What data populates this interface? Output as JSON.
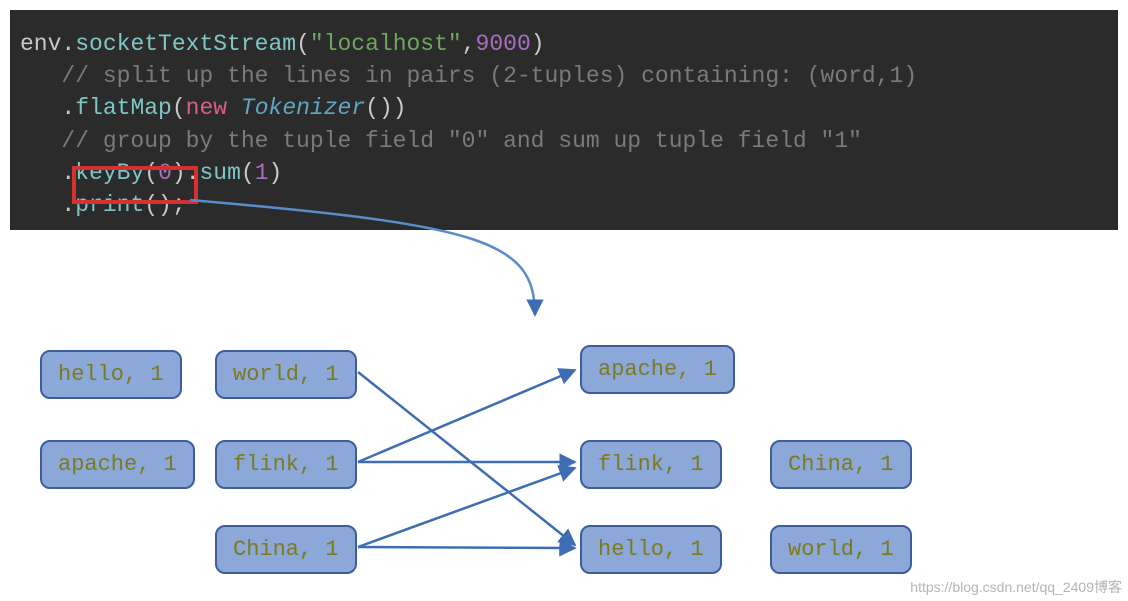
{
  "code": {
    "line1": {
      "env": "env",
      "dot1": ".",
      "method": "socketTextStream",
      "open": "(",
      "str": "\"localhost\"",
      "comma": ",",
      "num": "9000",
      "close": ")"
    },
    "line2_comment": "   // split up the lines in pairs (2-tuples) containing: (word,1)",
    "line3": {
      "indent": "   ",
      "dot": ".",
      "method": "flatMap",
      "open": "(",
      "kw": "new",
      "space": " ",
      "cls": "Tokenizer",
      "parens": "()",
      "close": ")"
    },
    "line4_comment": "   // group by the tuple field \"0\" and sum up tuple field \"1\"",
    "line5": {
      "indent": "   ",
      "dot1": ".",
      "method1": "keyBy",
      "open1": "(",
      "num1": "0",
      "close1": ")",
      "dot2": ".",
      "method2": "sum",
      "open2": "(",
      "num2": "1",
      "close2": ")"
    },
    "line6": {
      "indent": "   ",
      "dot": ".",
      "method": "print",
      "parens": "();"
    }
  },
  "tuples_left": [
    {
      "label": "hello, 1"
    },
    {
      "label": "world, 1"
    },
    {
      "label": "apache, 1"
    },
    {
      "label": "flink, 1"
    },
    {
      "label": "China, 1"
    }
  ],
  "tuples_right": [
    {
      "label": "apache, 1"
    },
    {
      "label": "flink, 1"
    },
    {
      "label": "China, 1"
    },
    {
      "label": "hello, 1"
    },
    {
      "label": "world, 1"
    }
  ],
  "arrows": [
    {
      "from": "world-l",
      "to": "hello-r"
    },
    {
      "from": "flink-l",
      "to": "apache-r"
    },
    {
      "from": "flink-l",
      "to": "flink-r"
    },
    {
      "from": "China-l",
      "to": "flink-r"
    },
    {
      "from": "China-l",
      "to": "hello-r"
    }
  ],
  "colors": {
    "code_bg": "#2b2b2b",
    "box_fill": "#8ca8d8",
    "box_border": "#3e5d9f",
    "box_text": "#7c7a1f",
    "arrow": "#3e6db3",
    "highlight": "#d43131"
  },
  "watermark": "https://blog.csdn.net/qq_2409博客"
}
